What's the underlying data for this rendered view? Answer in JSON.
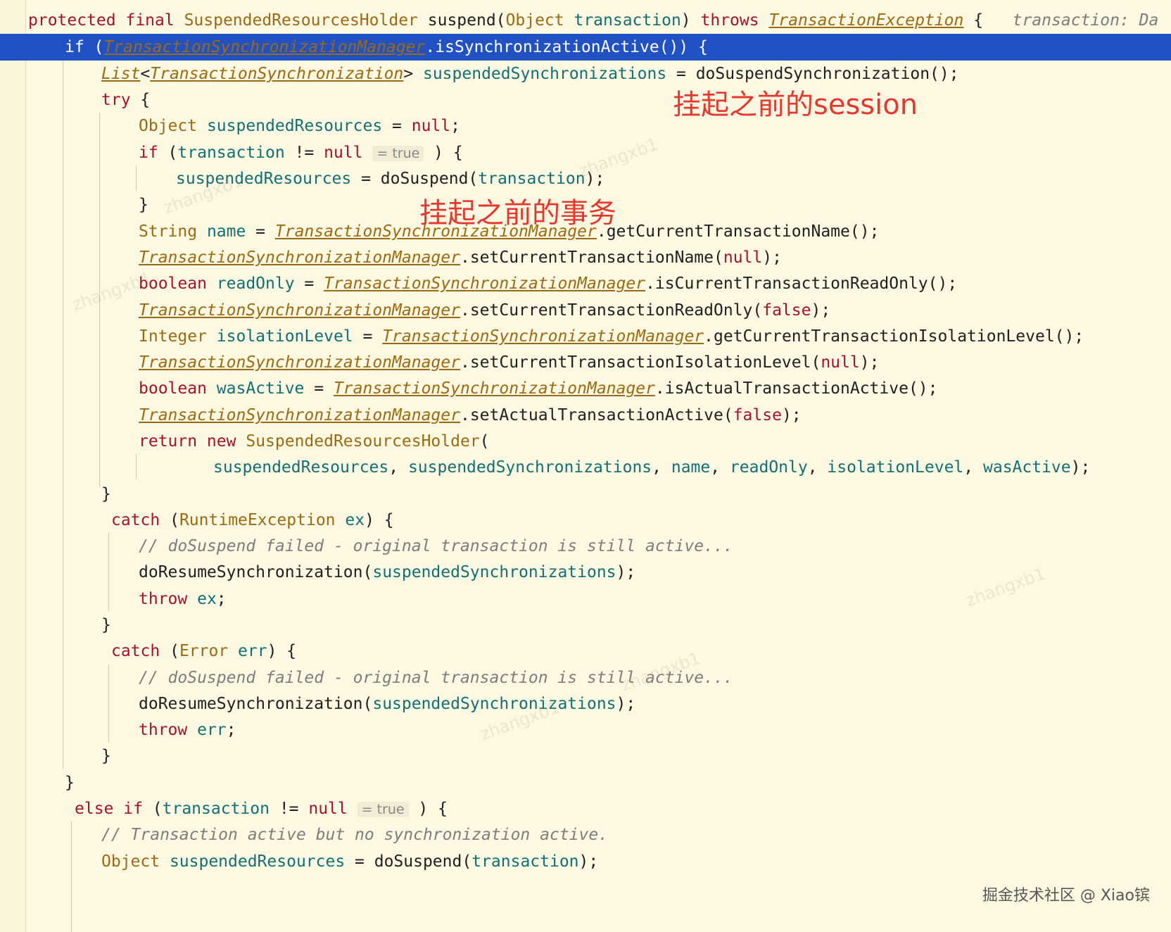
{
  "lines": [
    {
      "segments": [
        [
          "kw",
          "protected final "
        ],
        [
          "cls",
          "SuspendedResourcesHolder "
        ],
        [
          "mth",
          "suspend("
        ],
        [
          "cls",
          "Object "
        ],
        [
          "fld",
          "transaction"
        ],
        [
          "mth",
          ") "
        ],
        [
          "kw",
          "throws "
        ],
        [
          "clsu",
          "TransactionException"
        ],
        [
          "mth",
          " {   "
        ],
        [
          "cm",
          "transaction: Da"
        ]
      ]
    },
    {
      "segments": [
        [
          "kw",
          "if "
        ],
        [
          "mth",
          "("
        ],
        [
          "clsu",
          "TransactionSynchronizationManager"
        ],
        [
          "mth",
          ".isSynchronizationActive()) {"
        ]
      ]
    },
    {
      "segments": [
        [
          "clsu",
          "List"
        ],
        [
          "mth",
          "<"
        ],
        [
          "clsu",
          "TransactionSynchronization"
        ],
        [
          "mth",
          "> "
        ],
        [
          "fld",
          "suspendedSynchronizations"
        ],
        [
          "mth",
          " = doSuspendSynchronization();"
        ]
      ]
    },
    {
      "segments": [
        [
          "kw",
          "try "
        ],
        [
          "mth",
          "{"
        ]
      ]
    },
    {
      "segments": [
        [
          "cls",
          "Object "
        ],
        [
          "fld",
          "suspendedResources"
        ],
        [
          "mth",
          " = "
        ],
        [
          "kw",
          "null"
        ],
        [
          "mth",
          ";"
        ]
      ]
    },
    {
      "segments": [
        [
          "kw",
          "if "
        ],
        [
          "mth",
          "("
        ],
        [
          "fld",
          "transaction"
        ],
        [
          "mth",
          " != "
        ],
        [
          "kw",
          "null "
        ],
        [
          "inl",
          "= true"
        ],
        [
          "mth",
          " ) {"
        ]
      ]
    },
    {
      "segments": [
        [
          "fld",
          "suspendedResources"
        ],
        [
          "mth",
          " = doSuspend("
        ],
        [
          "fld",
          "transaction"
        ],
        [
          "mth",
          ");"
        ]
      ]
    },
    {
      "segments": [
        [
          "mth",
          "}"
        ]
      ]
    },
    {
      "segments": [
        [
          "cls",
          "String "
        ],
        [
          "fld",
          "name"
        ],
        [
          "mth",
          " = "
        ],
        [
          "clsu",
          "TransactionSynchronizationManager"
        ],
        [
          "mth",
          ".getCurrentTransactionName();"
        ]
      ]
    },
    {
      "segments": [
        [
          "clsu",
          "TransactionSynchronizationManager"
        ],
        [
          "mth",
          ".setCurrentTransactionName("
        ],
        [
          "kw",
          "null"
        ],
        [
          "mth",
          ");"
        ]
      ]
    },
    {
      "segments": [
        [
          "kw",
          "boolean "
        ],
        [
          "fld",
          "readOnly"
        ],
        [
          "mth",
          " = "
        ],
        [
          "clsu",
          "TransactionSynchronizationManager"
        ],
        [
          "mth",
          ".isCurrentTransactionReadOnly();"
        ]
      ]
    },
    {
      "segments": [
        [
          "clsu",
          "TransactionSynchronizationManager"
        ],
        [
          "mth",
          ".setCurrentTransactionReadOnly("
        ],
        [
          "kw",
          "false"
        ],
        [
          "mth",
          ");"
        ]
      ]
    },
    {
      "segments": [
        [
          "cls",
          "Integer "
        ],
        [
          "fld",
          "isolationLevel"
        ],
        [
          "mth",
          " = "
        ],
        [
          "clsu",
          "TransactionSynchronizationManager"
        ],
        [
          "mth",
          ".getCurrentTransactionIsolationLevel();"
        ]
      ]
    },
    {
      "segments": [
        [
          "clsu",
          "TransactionSynchronizationManager"
        ],
        [
          "mth",
          ".setCurrentTransactionIsolationLevel("
        ],
        [
          "kw",
          "null"
        ],
        [
          "mth",
          ");"
        ]
      ]
    },
    {
      "segments": [
        [
          "kw",
          "boolean "
        ],
        [
          "fld",
          "wasActive"
        ],
        [
          "mth",
          " = "
        ],
        [
          "clsu",
          "TransactionSynchronizationManager"
        ],
        [
          "mth",
          ".isActualTransactionActive();"
        ]
      ]
    },
    {
      "segments": [
        [
          "clsu",
          "TransactionSynchronizationManager"
        ],
        [
          "mth",
          ".setActualTransactionActive("
        ],
        [
          "kw",
          "false"
        ],
        [
          "mth",
          ");"
        ]
      ]
    },
    {
      "segments": [
        [
          "kw",
          "return new "
        ],
        [
          "cls",
          "SuspendedResourcesHolder"
        ],
        [
          "mth",
          "("
        ]
      ]
    },
    {
      "segments": [
        [
          "fld",
          "suspendedResources"
        ],
        [
          "mth",
          ", "
        ],
        [
          "fld",
          "suspendedSynchronizations"
        ],
        [
          "mth",
          ", "
        ],
        [
          "fld",
          "name"
        ],
        [
          "mth",
          ", "
        ],
        [
          "fld",
          "readOnly"
        ],
        [
          "mth",
          ", "
        ],
        [
          "fld",
          "isolationLevel"
        ],
        [
          "mth",
          ", "
        ],
        [
          "fld",
          "wasActive"
        ],
        [
          "mth",
          ");"
        ]
      ]
    },
    {
      "segments": [
        [
          "mth",
          "}"
        ]
      ]
    },
    {
      "segments": [
        [
          "kw",
          "catch "
        ],
        [
          "mth",
          "("
        ],
        [
          "cls",
          "RuntimeException "
        ],
        [
          "fld",
          "ex"
        ],
        [
          "mth",
          ") {"
        ]
      ]
    },
    {
      "segments": [
        [
          "cm",
          "// doSuspend failed - original transaction is still active..."
        ]
      ]
    },
    {
      "segments": [
        [
          "mth",
          "doResumeSynchronization("
        ],
        [
          "fld",
          "suspendedSynchronizations"
        ],
        [
          "mth",
          ");"
        ]
      ]
    },
    {
      "segments": [
        [
          "kw",
          "throw "
        ],
        [
          "fld",
          "ex"
        ],
        [
          "mth",
          ";"
        ]
      ]
    },
    {
      "segments": [
        [
          "mth",
          "}"
        ]
      ]
    },
    {
      "segments": [
        [
          "kw",
          "catch "
        ],
        [
          "mth",
          "("
        ],
        [
          "cls",
          "Error "
        ],
        [
          "fld",
          "err"
        ],
        [
          "mth",
          ") {"
        ]
      ]
    },
    {
      "segments": [
        [
          "cm",
          "// doSuspend failed - original transaction is still active..."
        ]
      ]
    },
    {
      "segments": [
        [
          "mth",
          "doResumeSynchronization("
        ],
        [
          "fld",
          "suspendedSynchronizations"
        ],
        [
          "mth",
          ");"
        ]
      ]
    },
    {
      "segments": [
        [
          "kw",
          "throw "
        ],
        [
          "fld",
          "err"
        ],
        [
          "mth",
          ";"
        ]
      ]
    },
    {
      "segments": [
        [
          "mth",
          "}"
        ]
      ]
    },
    {
      "segments": [
        [
          "mth",
          "}"
        ]
      ]
    },
    {
      "segments": [
        [
          "kw",
          "else if "
        ],
        [
          "mth",
          "("
        ],
        [
          "fld",
          "transaction"
        ],
        [
          "mth",
          " != "
        ],
        [
          "kw",
          "null "
        ],
        [
          "inl",
          "= true"
        ],
        [
          "mth",
          " ) {"
        ]
      ]
    },
    {
      "segments": [
        [
          "cm",
          "// Transaction active but no synchronization active."
        ]
      ]
    },
    {
      "segments": [
        [
          "cls",
          "Object "
        ],
        [
          "fld",
          "suspendedResources"
        ],
        [
          "mth",
          " = doSuspend("
        ],
        [
          "fld",
          "transaction"
        ],
        [
          "mth",
          ");"
        ]
      ]
    }
  ],
  "annotations": {
    "session_note": "挂起之前的session",
    "transaction_note": "挂起之前的事务"
  },
  "footer": "掘金技术社区 @ Xiao镔",
  "watermark_text": "zhangxb1"
}
